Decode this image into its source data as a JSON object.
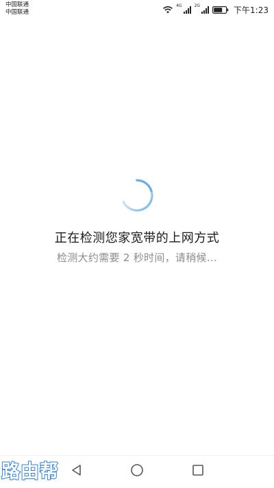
{
  "status_bar": {
    "carrier_1": "中国联通",
    "carrier_2": "中国联通",
    "network_1": "4G",
    "network_2": "2G",
    "time": "下午1:23",
    "icons": [
      "wifi-icon",
      "signal-icon",
      "signal-icon",
      "battery-icon"
    ]
  },
  "main": {
    "title": "正在检测您家宽带的上网方式",
    "subtitle": "检测大约需要 2 秒时间，请稍候...",
    "spinner_color": "#6aaee6"
  },
  "nav_bar": {
    "icons": [
      "back-triangle-icon",
      "home-circle-icon",
      "recent-square-icon"
    ]
  },
  "watermark": {
    "text": "路由帮",
    "color": "#2f7fd8"
  }
}
